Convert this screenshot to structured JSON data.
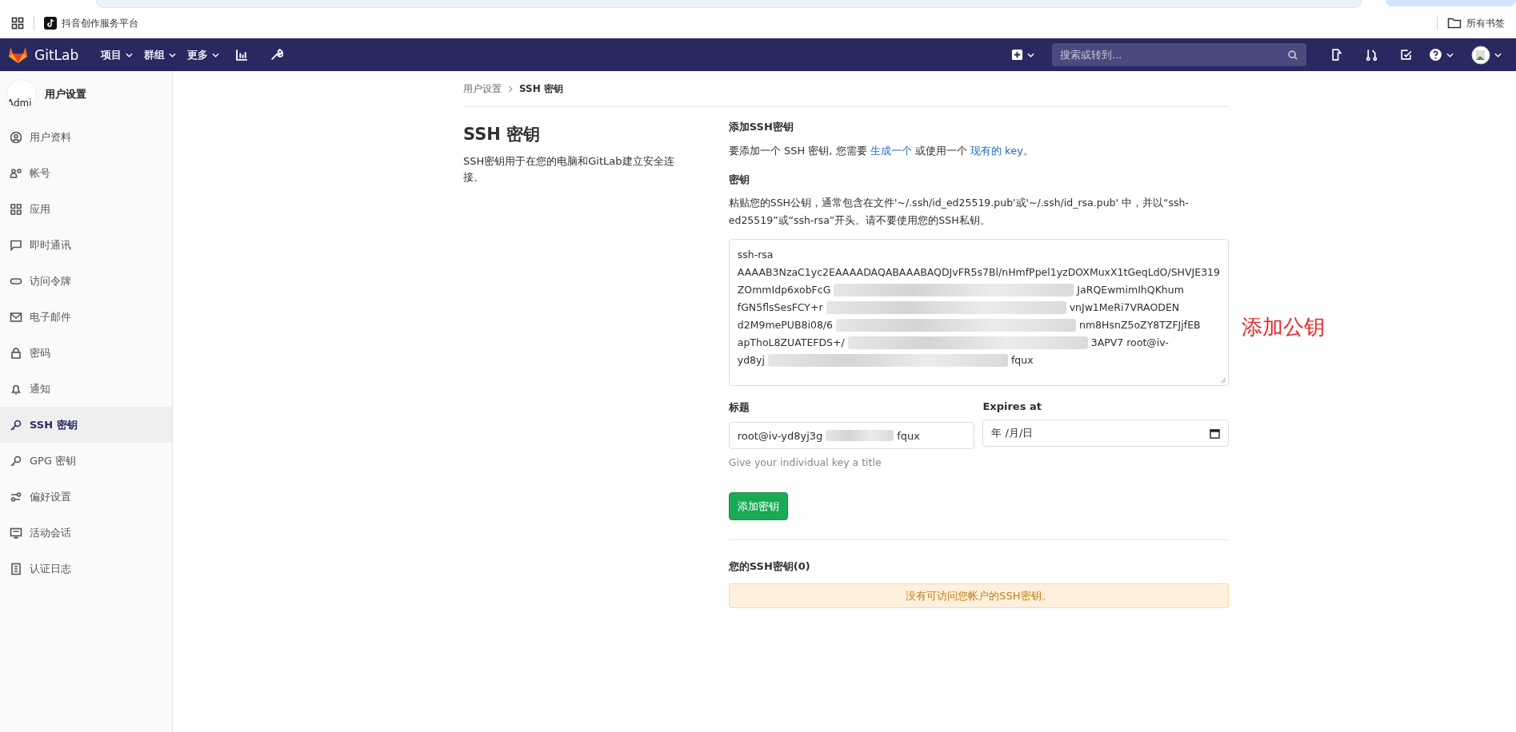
{
  "browser_bar": {
    "bookmarks": [
      {
        "label": "抖音创作服务平台"
      }
    ],
    "all_bookmarks": "所有书签"
  },
  "navbar": {
    "brand": "GitLab",
    "menus": [
      {
        "label": "项目"
      },
      {
        "label": "群组"
      },
      {
        "label": "更多"
      }
    ],
    "search": {
      "placeholder": "搜索或转到..."
    }
  },
  "sidebar": {
    "avatar_alt": "Admi",
    "title": "用户设置",
    "items": [
      {
        "label": "用户资料",
        "selected": false
      },
      {
        "label": "帐号",
        "selected": false
      },
      {
        "label": "应用",
        "selected": false
      },
      {
        "label": "即时通讯",
        "selected": false
      },
      {
        "label": "访问令牌",
        "selected": false
      },
      {
        "label": "电子邮件",
        "selected": false
      },
      {
        "label": "密码",
        "selected": false
      },
      {
        "label": "通知",
        "selected": false
      },
      {
        "label": "SSH 密钥",
        "selected": true
      },
      {
        "label": "GPG 密钥",
        "selected": false
      },
      {
        "label": "偏好设置",
        "selected": false
      },
      {
        "label": "活动会话",
        "selected": false
      },
      {
        "label": "认证日志",
        "selected": false
      }
    ]
  },
  "breadcrumb": [
    {
      "label": "用户设置"
    },
    {
      "label": "SSH 密钥"
    }
  ],
  "page": {
    "title": "SSH 密钥",
    "description": "SSH密钥用于在您的电脑和GitLab建立安全连接。"
  },
  "form": {
    "heading": "添加SSH密钥",
    "intro": {
      "before": "要添加一个 SSH 密钥, 您需要",
      "link1": "生成一个",
      "middle": "或使用一个",
      "link2": "现有的 key",
      "after": "。"
    },
    "key_label": "密钥",
    "key_help": "粘贴您的SSH公钥，通常包含在文件'~/.ssh/id_ed25519.pub'或'~/.ssh/id_rsa.pub' 中，并以“ssh-ed25519”或“ssh-rsa”开头。请不要使用您的SSH私钥。",
    "key_lines": [
      [
        "ssh-rsa"
      ],
      [
        "AAAAB3NzaC1yc2EAAAADAQABAAABAQDJvFR5s7Bl/nHmfPpel1yzDOXMuxX1tGeqLdO/SHVJE319"
      ],
      [
        "ZOmmIdp6xobFcG",
        "JaRQEwmimIhQKhum"
      ],
      [
        "fGN5flsSesFCY+r",
        "vnJw1MeRi7VRAODEN"
      ],
      [
        "d2M9mePUB8i08/6",
        "nm8HsnZ5oZY8TZFJjfEB"
      ],
      [
        "apThoL8ZUATEFDS+/",
        "3APV7 root@iv-"
      ],
      [
        "yd8yj",
        "fqux"
      ]
    ],
    "title_label": "标题",
    "title_value": [
      "root@iv-yd8yj3g",
      "fqux"
    ],
    "title_help": "Give your individual key a title",
    "expires_label": "Expires at",
    "expires_value": "年 /月/日",
    "submit": "添加密钥"
  },
  "keys_section": {
    "heading": "您的SSH密钥(0)",
    "empty_message": "没有可访问您帐户的SSH密钥。"
  },
  "annotation": "添加公钥"
}
